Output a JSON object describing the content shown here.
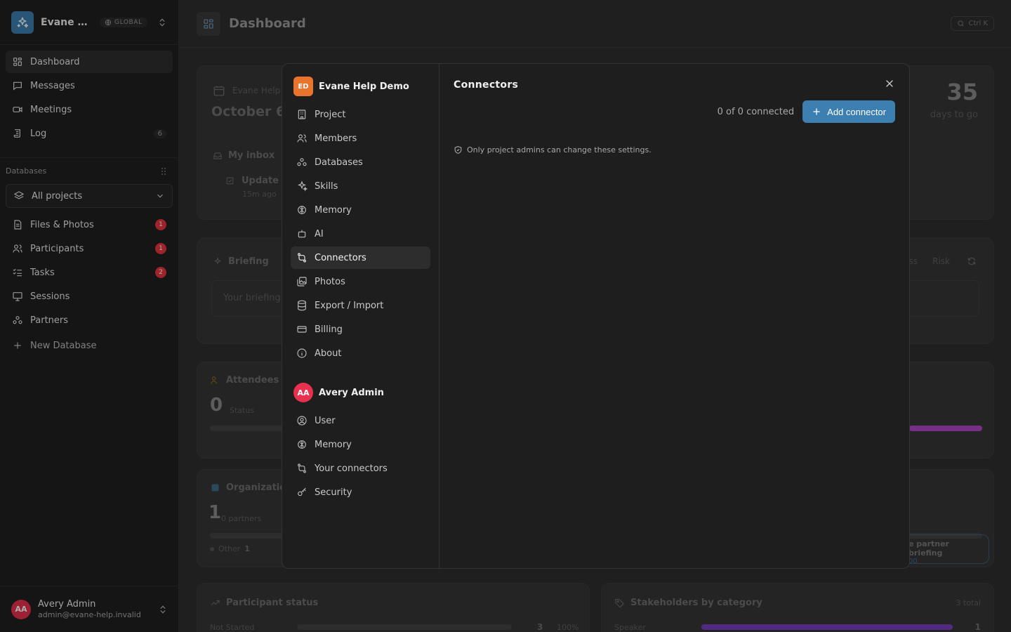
{
  "workspace": {
    "name": "Evane He...",
    "scope_badge": "GLOBAL"
  },
  "nav": {
    "main": [
      {
        "label": "Dashboard"
      },
      {
        "label": "Messages"
      },
      {
        "label": "Meetings"
      },
      {
        "label": "Log",
        "count": "6"
      }
    ],
    "databases_title": "Databases",
    "project_select": "All projects",
    "databases": [
      {
        "label": "Files & Photos",
        "badge": "1"
      },
      {
        "label": "Participants",
        "badge": "1"
      },
      {
        "label": "Tasks",
        "badge": "2"
      },
      {
        "label": "Sessions"
      },
      {
        "label": "Partners"
      }
    ],
    "new_database": "New Database"
  },
  "user": {
    "initials": "AA",
    "name": "Avery Admin",
    "email": "admin@evane-help.invalid"
  },
  "page": {
    "title": "Dashboard",
    "shortcut": "Ctrl K"
  },
  "background": {
    "event_card": {
      "org": "Evane Help",
      "date": "October 6",
      "inbox": "My inbox",
      "update": "Update",
      "time": "15m ago",
      "days_value": "35",
      "days_label": "days to go"
    },
    "briefing": {
      "title": "Briefing",
      "placeholder": "Your briefing",
      "tab_ss": "ss",
      "tab_risk": "Risk"
    },
    "attendees": {
      "title": "Attendees (",
      "value": "0",
      "label": "Status"
    },
    "organization": {
      "title": "Organization",
      "value": "1",
      "label": "0 partners",
      "legend": "Other",
      "legend_value": "1",
      "link": "e partner briefing",
      "link_sub": "00"
    },
    "participant_status": {
      "title": "Participant status",
      "row_label": "Not Started",
      "row_value": "3",
      "row_pct": "100%"
    },
    "stakeholders": {
      "title": "Stakeholders by category",
      "total": "3 total",
      "row_label": "Speaker",
      "row_value": "1"
    }
  },
  "modal": {
    "project": {
      "initials": "ED",
      "title": "Evane Help Demo",
      "items": [
        {
          "label": "Project"
        },
        {
          "label": "Members"
        },
        {
          "label": "Databases"
        },
        {
          "label": "Skills"
        },
        {
          "label": "Memory"
        },
        {
          "label": "AI"
        },
        {
          "label": "Connectors"
        },
        {
          "label": "Photos"
        },
        {
          "label": "Export / Import"
        },
        {
          "label": "Billing"
        },
        {
          "label": "About"
        }
      ]
    },
    "account": {
      "initials": "AA",
      "title": "Avery Admin",
      "items": [
        {
          "label": "User"
        },
        {
          "label": "Memory"
        },
        {
          "label": "Your connectors"
        },
        {
          "label": "Security"
        }
      ]
    },
    "content": {
      "title": "Connectors",
      "connected": "0 of 0 connected",
      "add_button": "Add connector",
      "note": "Only project admins can change these settings."
    }
  },
  "colors": {
    "accent": "#3d7fb0",
    "danger_badge": "#e8353d",
    "avatar": "#e8314e",
    "project_logo": "#e8742e"
  }
}
